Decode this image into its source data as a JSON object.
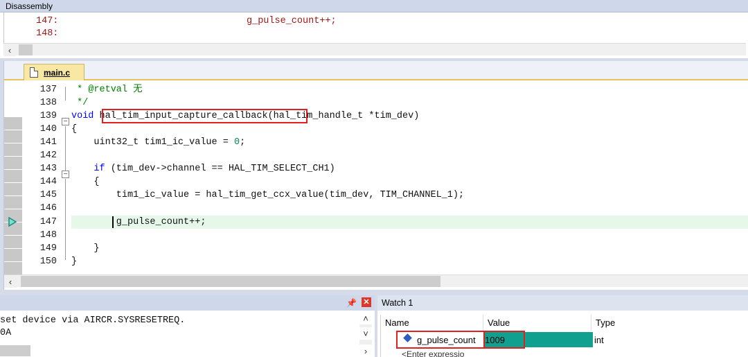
{
  "disassembly": {
    "title": "Disassembly",
    "lines": [
      {
        "num": "147:",
        "code": "g_pulse_count++;"
      },
      {
        "num": "148:",
        "code": ""
      }
    ]
  },
  "editor": {
    "tab_label": "main.c",
    "lines": [
      {
        "num": "137",
        "text": " * @retval 无"
      },
      {
        "num": "138",
        "text": " */"
      },
      {
        "num": "139",
        "pre": "void ",
        "fn": "hal_tim_input_capture_callback",
        "post": "(hal_tim_handle_t *tim_dev)"
      },
      {
        "num": "140",
        "text": "{"
      },
      {
        "num": "141",
        "pre": "    uint32_t tim1_ic_value = ",
        "value": "0",
        "post": ";"
      },
      {
        "num": "142",
        "text": ""
      },
      {
        "num": "143",
        "kw": "    if",
        "post": " (tim_dev->channel == HAL_TIM_SELECT_CH1)"
      },
      {
        "num": "144",
        "text": "    {"
      },
      {
        "num": "145",
        "text": "        tim1_ic_value = hal_tim_get_ccx_value(tim_dev, TIM_CHANNEL_1);"
      },
      {
        "num": "146",
        "text": ""
      },
      {
        "num": "147",
        "text": "        g_pulse_count++;"
      },
      {
        "num": "148",
        "text": ""
      },
      {
        "num": "149",
        "text": "    }"
      },
      {
        "num": "150",
        "text": "}"
      }
    ]
  },
  "command": {
    "lines": [
      "set device via AIRCR.SYSRESETREQ.",
      "0A"
    ],
    "pin_icon": "pin-icon",
    "close_icon": "close-icon"
  },
  "watch": {
    "title": "Watch 1",
    "columns": [
      "Name",
      "Value",
      "Type"
    ],
    "rows": [
      {
        "name": "g_pulse_count",
        "value": "1009",
        "type": "int"
      }
    ],
    "placeholder": "<Enter expressio"
  },
  "colors": {
    "highlight_box": "#e02020",
    "watch_value_bg": "#0fa090",
    "current_line_bg": "#e5f8ea"
  }
}
